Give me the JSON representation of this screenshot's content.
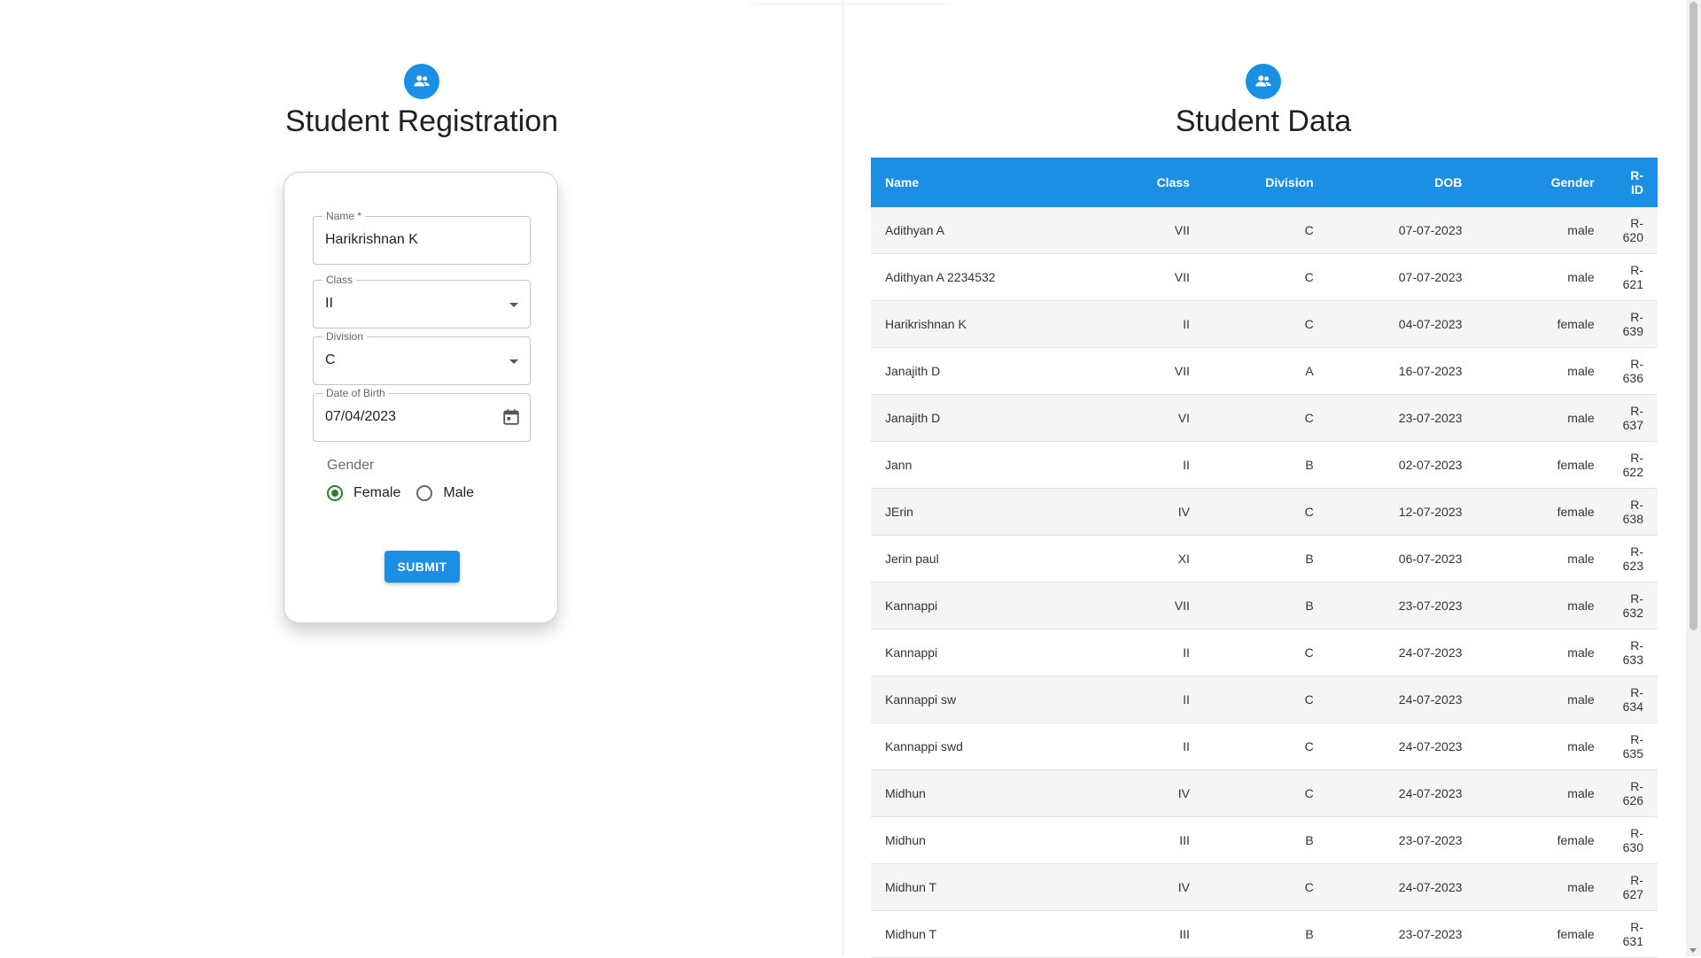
{
  "registration": {
    "title": "Student Registration",
    "fields": {
      "name_label": "Name *",
      "name_value": "Harikrishnan K",
      "class_label": "Class",
      "class_value": "II",
      "division_label": "Division",
      "division_value": "C",
      "dob_label": "Date of Birth",
      "dob_value": "07/04/2023"
    },
    "gender": {
      "label": "Gender",
      "options": [
        "Female",
        "Male"
      ],
      "selected": "Female"
    },
    "submit_label": "SUBMIT"
  },
  "data_panel": {
    "title": "Student Data",
    "columns": [
      "Name",
      "Class",
      "Division",
      "DOB",
      "Gender",
      "R-ID"
    ],
    "rows": [
      [
        "Adithyan A",
        "VII",
        "C",
        "07-07-2023",
        "male",
        "R-620"
      ],
      [
        "Adithyan A 2234532",
        "VII",
        "C",
        "07-07-2023",
        "male",
        "R-621"
      ],
      [
        "Harikrishnan K",
        "II",
        "C",
        "04-07-2023",
        "female",
        "R-639"
      ],
      [
        "Janajith D",
        "VII",
        "A",
        "16-07-2023",
        "male",
        "R-636"
      ],
      [
        "Janajith D",
        "VI",
        "C",
        "23-07-2023",
        "male",
        "R-637"
      ],
      [
        "Jann",
        "II",
        "B",
        "02-07-2023",
        "female",
        "R-622"
      ],
      [
        "JErin",
        "IV",
        "C",
        "12-07-2023",
        "female",
        "R-638"
      ],
      [
        "Jerin paul",
        "XI",
        "B",
        "06-07-2023",
        "male",
        "R-623"
      ],
      [
        "Kannappi",
        "VII",
        "B",
        "23-07-2023",
        "male",
        "R-632"
      ],
      [
        "Kannappi",
        "II",
        "C",
        "24-07-2023",
        "male",
        "R-633"
      ],
      [
        "Kannappi sw",
        "II",
        "C",
        "24-07-2023",
        "male",
        "R-634"
      ],
      [
        "Kannappi swd",
        "II",
        "C",
        "24-07-2023",
        "male",
        "R-635"
      ],
      [
        "Midhun",
        "IV",
        "C",
        "24-07-2023",
        "male",
        "R-626"
      ],
      [
        "Midhun",
        "III",
        "B",
        "23-07-2023",
        "female",
        "R-630"
      ],
      [
        "Midhun T",
        "IV",
        "C",
        "24-07-2023",
        "male",
        "R-627"
      ],
      [
        "Midhun T",
        "III",
        "B",
        "23-07-2023",
        "female",
        "R-631"
      ]
    ]
  },
  "icons": {
    "avatar": "people-icon",
    "dob": "calendar-icon",
    "select": "caret-down-icon"
  },
  "colors": {
    "primary": "#1a8fe3",
    "radio_selected": "#2e7d32"
  }
}
